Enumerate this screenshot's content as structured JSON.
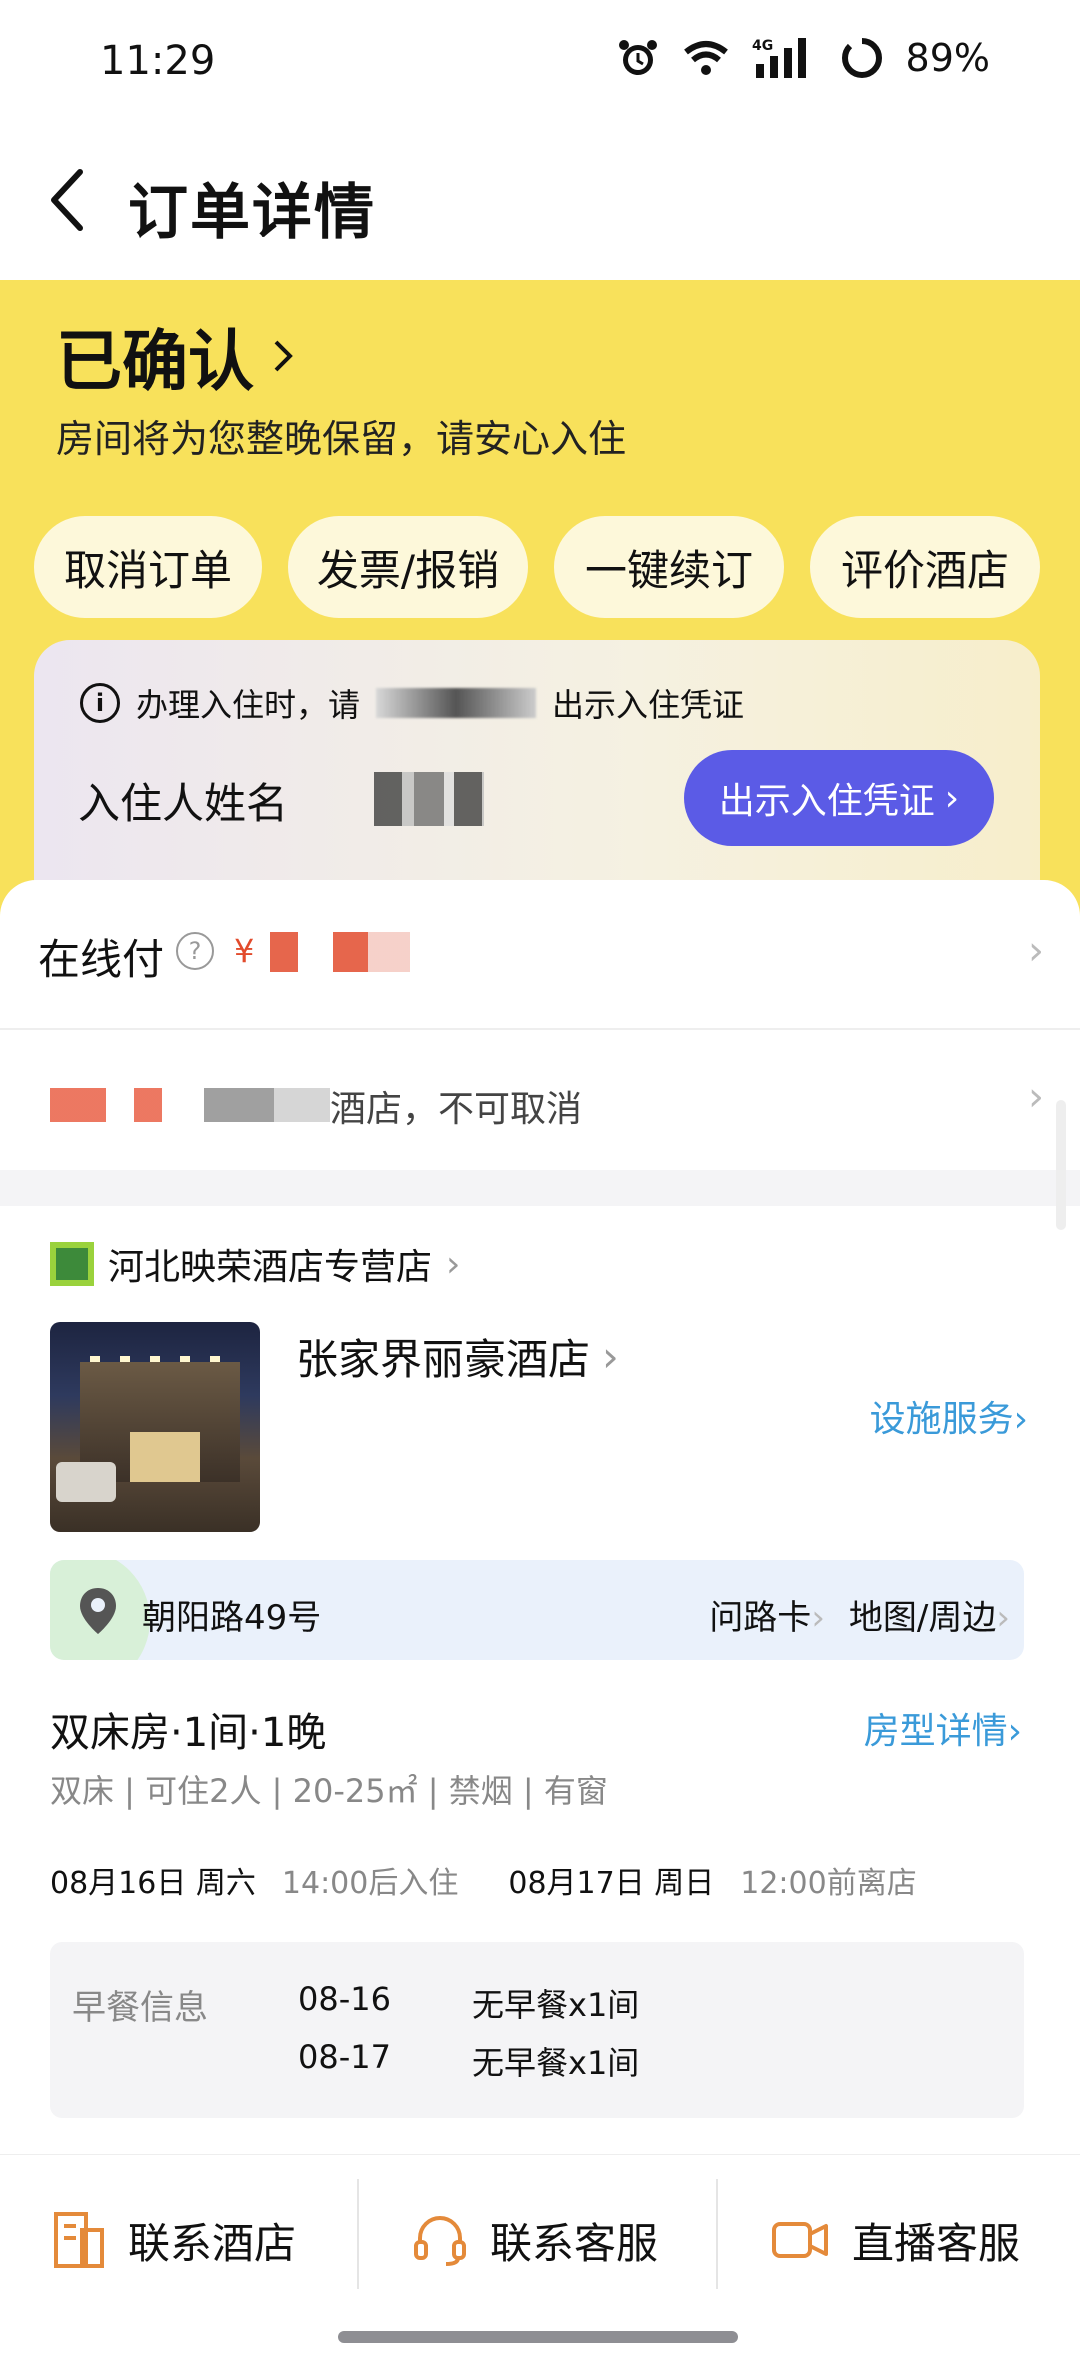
{
  "status_bar": {
    "time": "11:29",
    "network": "4G",
    "battery": "89%"
  },
  "nav": {
    "title": "订单详情"
  },
  "order": {
    "status": "已确认",
    "status_sub": "房间将为您整晚保留，请安心入住",
    "actions": [
      "取消订单",
      "发票/报销",
      "一键续订",
      "评价酒店"
    ]
  },
  "voucher": {
    "note_start": "办理入住时，请",
    "note_end": "出示入住凭证",
    "guest_label": "入住人姓名",
    "button": "出示入住凭证"
  },
  "payment": {
    "label": "在线付",
    "currency": "¥"
  },
  "policy": {
    "text": "酒店，不可取消"
  },
  "shop": {
    "name": "河北映荣酒店专营店"
  },
  "hotel": {
    "name": "张家界丽豪酒店",
    "facility_link": "设施服务",
    "address": "朝阳路49号",
    "address_links": [
      "问路卡",
      "地图/周边"
    ]
  },
  "room": {
    "title": "双床房·1间·1晚",
    "detail_link": "房型详情",
    "spec": "双床 | 可住2人 | 20-25㎡ | 禁烟 | 有窗",
    "checkin_date": "08月16日  周六",
    "checkin_time": "14:00后入住",
    "checkout_date": "08月17日  周日",
    "checkout_time": "12:00前离店"
  },
  "breakfast": {
    "label": "早餐信息",
    "rows": [
      {
        "date": "08-16",
        "value": "无早餐x1间"
      },
      {
        "date": "08-17",
        "value": "无早餐x1间"
      }
    ]
  },
  "bottom": {
    "contact_hotel": "联系酒店",
    "contact_service": "联系客服",
    "live_service": "直播客服"
  },
  "colors": {
    "header_yellow": "#f8e15b",
    "accent_purple": "#5b5be6",
    "link_blue": "#3a9ad9",
    "price_red": "#e24b2c"
  }
}
